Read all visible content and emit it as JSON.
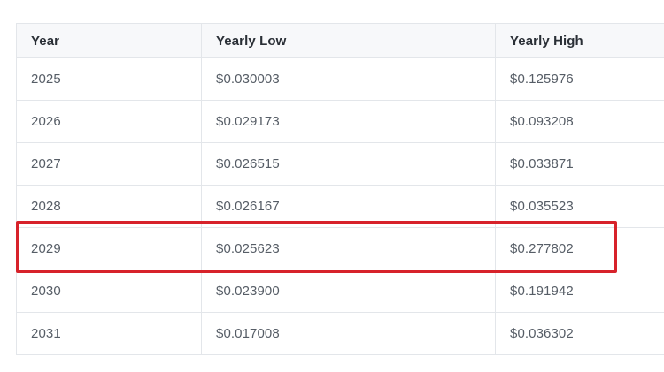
{
  "table": {
    "headers": [
      "Year",
      "Yearly Low",
      "Yearly High"
    ],
    "rows": [
      {
        "year": "2025",
        "low": "$0.030003",
        "high": "$0.125976"
      },
      {
        "year": "2026",
        "low": "$0.029173",
        "high": "$0.093208"
      },
      {
        "year": "2027",
        "low": "$0.026515",
        "high": "$0.033871"
      },
      {
        "year": "2028",
        "low": "$0.026167",
        "high": "$0.035523"
      },
      {
        "year": "2029",
        "low": "$0.025623",
        "high": "$0.277802"
      },
      {
        "year": "2030",
        "low": "$0.023900",
        "high": "$0.191942"
      },
      {
        "year": "2031",
        "low": "$0.017008",
        "high": "$0.036302"
      }
    ]
  },
  "highlight": {
    "row_year": "2029",
    "color": "#d7222a"
  }
}
